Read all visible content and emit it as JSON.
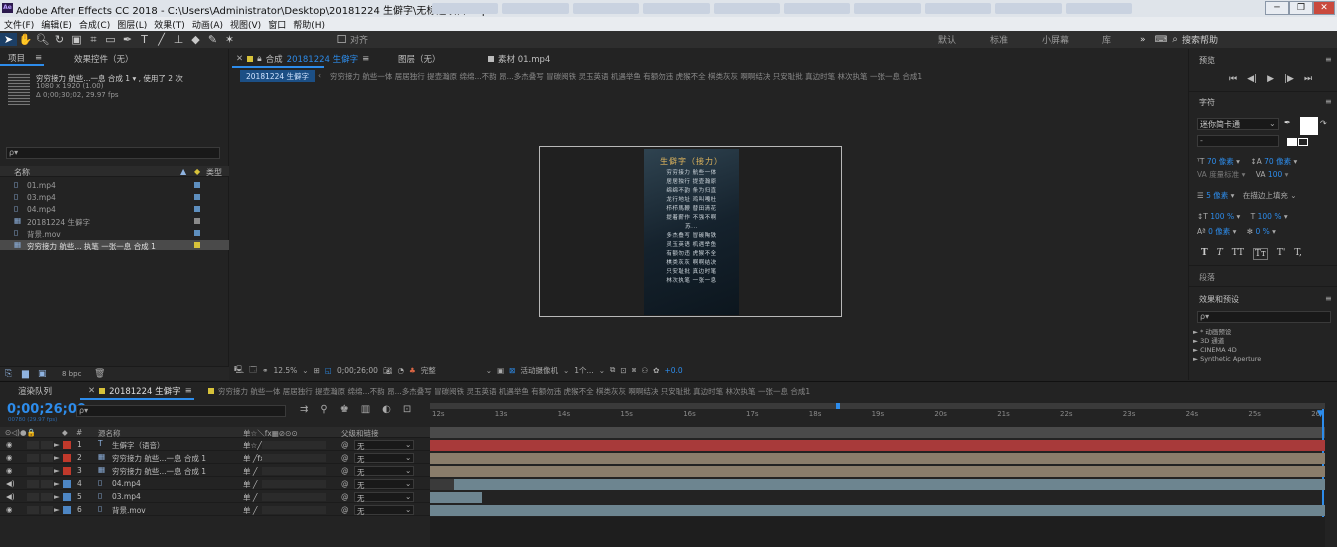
{
  "window": {
    "title": "Adobe After Effects CC 2018 - C:\\Users\\Administrator\\Desktop\\20181224 生僻字\\无标题项目.aep",
    "app_icon": "Ae",
    "controls": [
      "─",
      "❐",
      "✕"
    ]
  },
  "menu": [
    "文件(F)",
    "编辑(E)",
    "合成(C)",
    "图层(L)",
    "效果(T)",
    "动画(A)",
    "视图(V)",
    "窗口",
    "帮助(H)"
  ],
  "toolbar": {
    "snap_label": "对齐",
    "workspaces": [
      "默认",
      "标准",
      "小屏幕",
      "库"
    ],
    "more": "»",
    "search_placeholder": "搜索帮助"
  },
  "project": {
    "tab_label": "项目",
    "tab_menu": "≡",
    "effects_tab": "效果控件（无）",
    "selected_name": "穷穷接力 航些...一息 合成 1",
    "selected_usage": "▾ , 使用了 2 次",
    "selected_dims": "1080 x 1920 (1.00)",
    "selected_time": "Δ 0;00;30;02, 29.97 fps",
    "search_icon": "ρ▾",
    "col_name": "名称",
    "col_type": "类型",
    "items": [
      {
        "name": "01.mp4",
        "color": "#5e8fbf"
      },
      {
        "name": "03.mp4",
        "color": "#5e8fbf"
      },
      {
        "name": "04.mp4",
        "color": "#5e8fbf"
      },
      {
        "name": "20181224 生僻字",
        "color": "#8a8a8a"
      },
      {
        "name": "背景.mov",
        "color": "#5e8fbf"
      },
      {
        "name": "穷穷接力 航些... 执笔 一张一息 合成 1",
        "color": "#d7c23a"
      }
    ],
    "footer_bpc": "8 bpc"
  },
  "composition": {
    "tab_prefix": "合成",
    "tab_comp": "20181224 生僻字",
    "tab_menu": "≡",
    "layer_tab": "图层（无）",
    "footage_tab": "素材 01.mp4",
    "breadcrumb_active": "20181224 生僻字",
    "breadcrumb_rest": "穷穷接力 航些一体 居居独行 提壶瀚原 绵绵...不韵 昂...多杰叠写 冒碳阅铁 灵玉英语 机遇举鱼 有额勿违 虎猴不全 棋类灰灰 啊啊结决 只安耻批 真边时笔 林次执笔 一张一息 合成1",
    "poster_title": "生僻字（接力）",
    "poster_lines": [
      "穷穷接力 航些一体",
      "居居独行 提壶瀚原",
      "绵绵不韵 条为归直",
      "龙行地址 鸡叫嘎杜",
      "栉栉馬鞭 替田清花",
      "提着薪作 不强不啊",
      "苏...",
      "多杰叠写 冒碳陶铁",
      "灵玉英语 机遇举鱼",
      "有额勿违 虎猴不全",
      "棋类灰灰 啊啊结决",
      "只安耻批 真边时笔",
      "林次执笔 一张一息"
    ],
    "zoom": "12.5%",
    "timecode": "0;00;26;00",
    "quality": "完整",
    "camera": "活动摄像机",
    "views": "1个...",
    "exposure": "+0.0"
  },
  "right_panel": {
    "preview_title": "预览",
    "preview_menu": "≡",
    "preview_controls": [
      "⏮",
      "◀|",
      "▶",
      "|▶",
      "⏭"
    ],
    "character_title": "字符",
    "character_menu": "≡",
    "font": "迷你简卡通",
    "font_style": "-",
    "size": "70 像素",
    "leading": "70 像素",
    "kerning": "度量标准",
    "tracking": "100",
    "stroke": "5 像素",
    "stroke_type": "在描边上填充",
    "vscale": "100 %",
    "hscale": "100 %",
    "baseline": "0 像素",
    "tsume": "0 %",
    "caps": [
      "T",
      "T",
      "TT",
      "Tт",
      "T'",
      "T,"
    ],
    "paragraph_title": "段落",
    "effects_title": "效果和预设",
    "effects_menu": "≡",
    "effects_search": "ρ▾",
    "effects_items": [
      "► * 动画预设",
      "► 3D 通道",
      "► CINEMA 4D",
      "► Synthetic Aperture"
    ]
  },
  "timeline": {
    "render_queue_tab": "渲染队列",
    "comp_tab": "20181224 生僻字",
    "tab_menu": "≡",
    "comp_chain": "穷穷接力 航些一体 居居独行 提壶瀚原 绵绵...不韵 昂...多杰叠写 冒碳阅铁 灵玉英语 机遇举鱼 有额勿违 虎猴不全 棋类灰灰 啊啊结决 只安耻批 真边时笔 林次执笔 一张一息 合成1",
    "timecode": "0;00;26;00",
    "subtime": "00780 (29.97 fps)",
    "search_icon": "ρ▾",
    "col_switches": "⊙◁)●🔒",
    "col_num": "#",
    "col_name": "源名称",
    "col_sw2": "单☆＼fx▦⊘⊙⊙",
    "col_parent": "父级和链接",
    "ruler": [
      "12s",
      "13s",
      "14s",
      "15s",
      "16s",
      "17s",
      "18s",
      "19s",
      "20s",
      "21s",
      "22s",
      "23s",
      "24s",
      "25s",
      "26"
    ],
    "layers": [
      {
        "num": "1",
        "label_color": "#c0392b",
        "type": "T",
        "name": "生僻字（语音）",
        "switch": "单☆╱",
        "parent": "无"
      },
      {
        "num": "2",
        "label_color": "#c0392b",
        "type": "▦",
        "name": "穷穷接力 航些...一息 合成 1",
        "switch": "单 ╱fx",
        "parent": "无"
      },
      {
        "num": "3",
        "label_color": "#c0392b",
        "type": "▦",
        "name": "穷穷接力 航些...一息 合成 1",
        "switch": "单 ╱",
        "parent": "无"
      },
      {
        "num": "4",
        "label_color": "#4d86c4",
        "type": "▯",
        "name": "04.mp4",
        "switch": "单 ╱",
        "parent": "无"
      },
      {
        "num": "5",
        "label_color": "#4d86c4",
        "type": "▯",
        "name": "03.mp4",
        "switch": "单 ╱",
        "parent": "无"
      },
      {
        "num": "6",
        "label_color": "#4d86c4",
        "type": "▯",
        "name": "背景.mov",
        "switch": "单 ╱",
        "parent": "无"
      }
    ],
    "parent_icon": "@"
  }
}
